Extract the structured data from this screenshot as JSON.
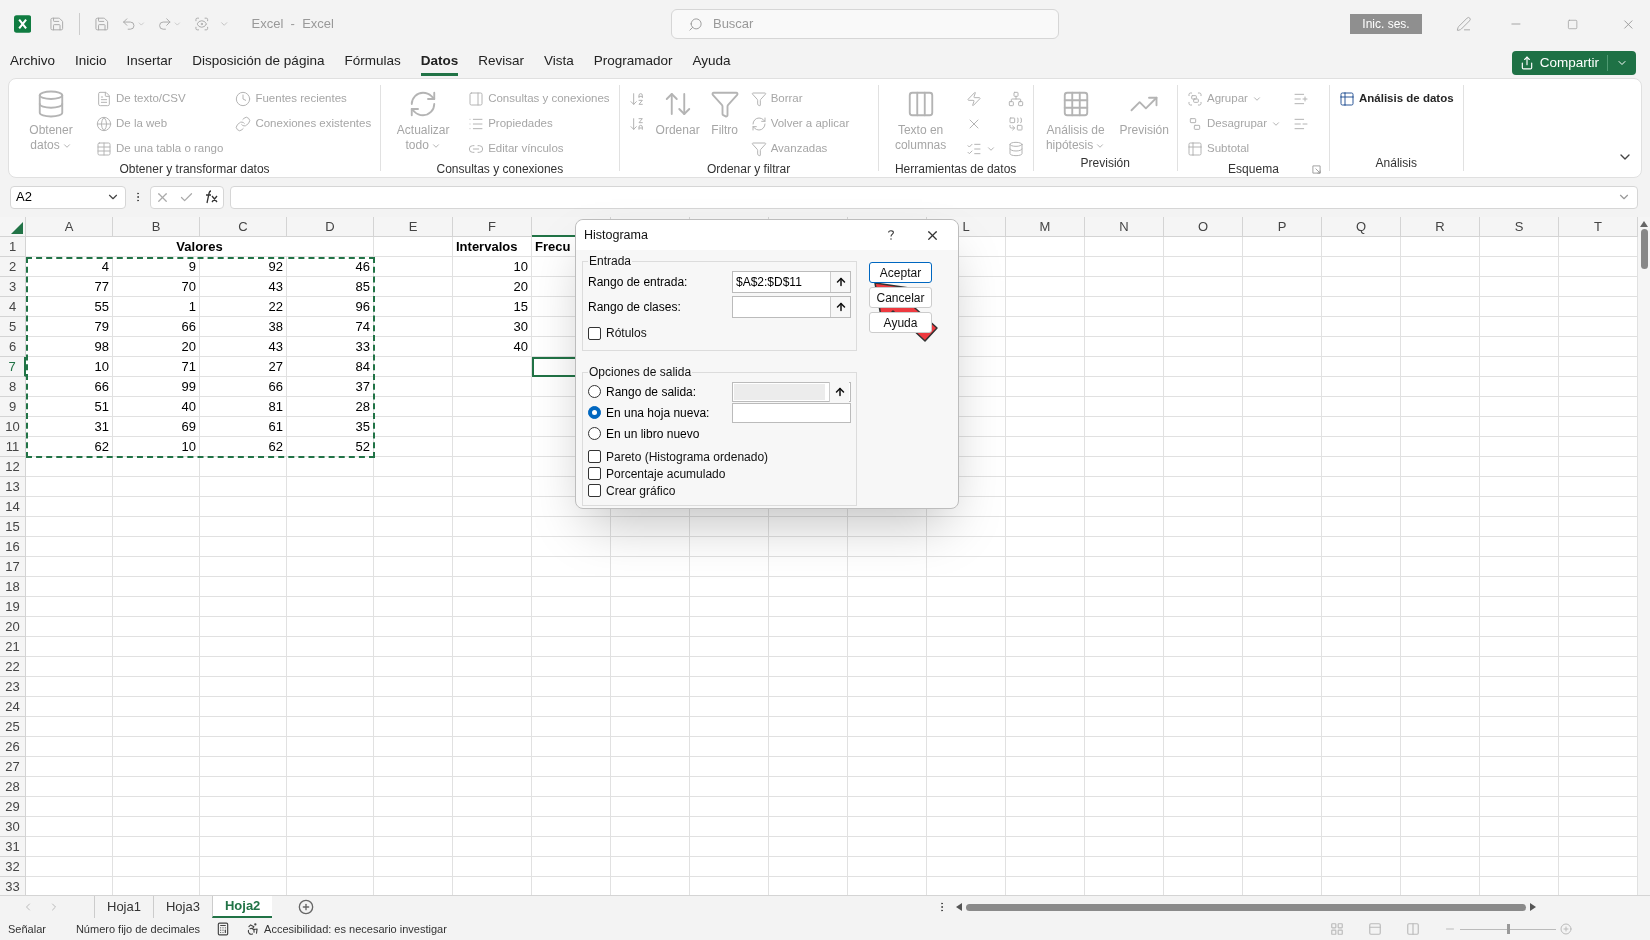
{
  "title_bar": {
    "title": "Excel  -  Excel",
    "search_placeholder": "Buscar",
    "sign_in": "Inic. ses."
  },
  "menu_tabs": [
    {
      "label": "Archivo",
      "selected": false
    },
    {
      "label": "Inicio",
      "selected": false
    },
    {
      "label": "Insertar",
      "selected": false
    },
    {
      "label": "Disposición de página",
      "selected": false
    },
    {
      "label": "Fórmulas",
      "selected": false
    },
    {
      "label": "Datos",
      "selected": true
    },
    {
      "label": "Revisar",
      "selected": false
    },
    {
      "label": "Vista",
      "selected": false
    },
    {
      "label": "Programador",
      "selected": false
    },
    {
      "label": "Ayuda",
      "selected": false
    }
  ],
  "share_button": "Compartir",
  "ribbon_groups": [
    {
      "label": "Obtener y transformar datos",
      "items": [
        {
          "kind": "large",
          "label": "Obtener datos",
          "dropdown": true,
          "disabled": true
        },
        {
          "kind": "column",
          "entries": [
            {
              "label": "De texto/CSV",
              "disabled": true
            },
            {
              "label": "De la web",
              "disabled": true
            },
            {
              "label": "De una tabla o rango",
              "disabled": true
            }
          ]
        },
        {
          "kind": "column",
          "entries": [
            {
              "label": "Fuentes recientes",
              "disabled": true
            },
            {
              "label": "Conexiones existentes",
              "disabled": true
            }
          ]
        }
      ]
    },
    {
      "label": "Consultas y conexiones",
      "items": [
        {
          "kind": "large",
          "label": "Actualizar todo",
          "dropdown": true,
          "disabled": true
        },
        {
          "kind": "column",
          "entries": [
            {
              "label": "Consultas y conexiones",
              "disabled": true
            },
            {
              "label": "Propiedades",
              "disabled": true
            },
            {
              "label": "Editar vínculos",
              "disabled": true
            }
          ]
        }
      ]
    },
    {
      "label": "Ordenar y filtrar",
      "items": [
        {
          "kind": "column",
          "entries": [
            {
              "disabled": true
            },
            {
              "disabled": true
            }
          ]
        },
        {
          "kind": "large",
          "label": "Ordenar",
          "disabled": true
        },
        {
          "kind": "large",
          "label": "Filtro",
          "disabled": true
        },
        {
          "kind": "column",
          "entries": [
            {
              "label": "Borrar",
              "disabled": true
            },
            {
              "label": "Volver a aplicar",
              "disabled": true
            },
            {
              "label": "Avanzadas",
              "disabled": true
            }
          ]
        }
      ]
    },
    {
      "label": "Herramientas de datos",
      "items": [
        {
          "kind": "large",
          "label": "Texto en columnas",
          "disabled": true
        },
        {
          "kind": "column",
          "entries": [
            {
              "disabled": true
            },
            {
              "disabled": true
            },
            {
              "disabled": true,
              "dropdown": true
            }
          ]
        },
        {
          "kind": "column",
          "entries": [
            {
              "disabled": true
            },
            {
              "disabled": true
            },
            {
              "disabled": true
            }
          ]
        }
      ]
    },
    {
      "label": "Previsión",
      "items": [
        {
          "kind": "large",
          "label": "Análisis de hipótesis",
          "dropdown": true,
          "disabled": true
        },
        {
          "kind": "large",
          "label": "Previsión",
          "disabled": true
        }
      ]
    },
    {
      "label": "Esquema",
      "dialog_launcher": true,
      "items": [
        {
          "kind": "column",
          "entries": [
            {
              "label": "Agrupar",
              "dropdown": true,
              "disabled": true
            },
            {
              "label": "Desagrupar",
              "dropdown": true,
              "disabled": true
            },
            {
              "label": "Subtotal",
              "disabled": true
            }
          ]
        },
        {
          "kind": "column",
          "entries": [
            {
              "disabled": true
            },
            {
              "disabled": true
            }
          ]
        }
      ]
    },
    {
      "label": "Análisis",
      "items": [
        {
          "kind": "column",
          "entries": [
            {
              "label": "Análisis de datos",
              "disabled": false
            }
          ]
        }
      ]
    }
  ],
  "formula_bar": {
    "name_box": "A2"
  },
  "sheet": {
    "columns_left": [
      "A",
      "B",
      "C",
      "D",
      "E",
      "F"
    ],
    "columns_right": [
      "L",
      "M",
      "N",
      "O",
      "P",
      "Q",
      "R",
      "S",
      "T"
    ],
    "rows": [
      {
        "number": "1",
        "title": "Valores",
        "interval": "Intervalos",
        "frequency": "Frecu",
        "selected": false
      },
      {
        "number": "2",
        "values": [
          "4",
          "9",
          "92",
          "46"
        ],
        "interval": "10",
        "selected": false
      },
      {
        "number": "3",
        "values": [
          "77",
          "70",
          "43",
          "85"
        ],
        "interval": "20",
        "selected": false
      },
      {
        "number": "4",
        "values": [
          "55",
          "1",
          "22",
          "96"
        ],
        "interval": "15",
        "selected": false
      },
      {
        "number": "5",
        "values": [
          "79",
          "66",
          "38",
          "74"
        ],
        "interval": "30",
        "selected": false
      },
      {
        "number": "6",
        "values": [
          "98",
          "20",
          "43",
          "33"
        ],
        "interval": "40",
        "selected": false
      },
      {
        "number": "7",
        "values": [
          "10",
          "71",
          "27",
          "84"
        ],
        "selected": true
      },
      {
        "number": "8",
        "values": [
          "66",
          "99",
          "66",
          "37"
        ],
        "selected": false
      },
      {
        "number": "9",
        "values": [
          "51",
          "40",
          "81",
          "28"
        ],
        "selected": false
      },
      {
        "number": "10",
        "values": [
          "31",
          "69",
          "61",
          "35"
        ],
        "selected": false
      },
      {
        "number": "11",
        "values": [
          "62",
          "10",
          "62",
          "52"
        ],
        "selected": false
      },
      {
        "number": "12",
        "selected": false
      },
      {
        "number": "13",
        "selected": false
      },
      {
        "number": "14",
        "selected": false
      },
      {
        "number": "15",
        "selected": false
      },
      {
        "number": "16",
        "selected": false
      },
      {
        "number": "17",
        "selected": false
      },
      {
        "number": "18",
        "selected": false
      },
      {
        "number": "19",
        "selected": false
      },
      {
        "number": "20",
        "selected": false
      },
      {
        "number": "21",
        "selected": false
      },
      {
        "number": "22",
        "selected": false
      },
      {
        "number": "23",
        "selected": false
      },
      {
        "number": "24",
        "selected": false
      },
      {
        "number": "25",
        "selected": false
      },
      {
        "number": "26",
        "selected": false
      },
      {
        "number": "27",
        "selected": false
      },
      {
        "number": "28",
        "selected": false
      },
      {
        "number": "29",
        "selected": false
      },
      {
        "number": "30",
        "selected": false
      },
      {
        "number": "31",
        "selected": false
      },
      {
        "number": "32",
        "selected": false
      },
      {
        "number": "33",
        "selected": false
      }
    ]
  },
  "dialog": {
    "title": "Histograma",
    "input_section": "Entrada",
    "input_range_label": "Rango de entrada:",
    "input_range_value": "$A$2:$D$11",
    "bin_range_label": "Rango de clases:",
    "labels_checkbox": {
      "label": "Rótulos",
      "checked": false
    },
    "output_section": "Opciones de salida",
    "output_options": [
      {
        "label": "Rango de salida:",
        "selected": false,
        "kind": "range"
      },
      {
        "label": "En una hoja nueva:",
        "selected": true,
        "kind": "text"
      },
      {
        "label": "En un libro nuevo",
        "selected": false,
        "kind": "plain"
      }
    ],
    "checkboxes": [
      {
        "label": "Pareto (Histograma ordenado)",
        "checked": false
      },
      {
        "label": "Porcentaje acumulado",
        "checked": false
      },
      {
        "label": "Crear gráfico",
        "checked": false
      }
    ],
    "buttons": [
      {
        "label": "Aceptar",
        "selected": true
      },
      {
        "label": "Cancelar",
        "selected": false
      },
      {
        "label": "Ayuda",
        "selected": false
      }
    ]
  },
  "sheet_tabs": [
    {
      "label": "Hoja1",
      "selected": false
    },
    {
      "label": "Hoja3",
      "selected": false
    },
    {
      "label": "Hoja2",
      "selected": true
    }
  ],
  "status_bar": {
    "mode": "Señalar",
    "fixed_decimal": "Número fijo de decimales",
    "accessibility": "Accesibilidad: es necesario investigar",
    "zoom_slider": {
      "level": 0.5
    }
  }
}
